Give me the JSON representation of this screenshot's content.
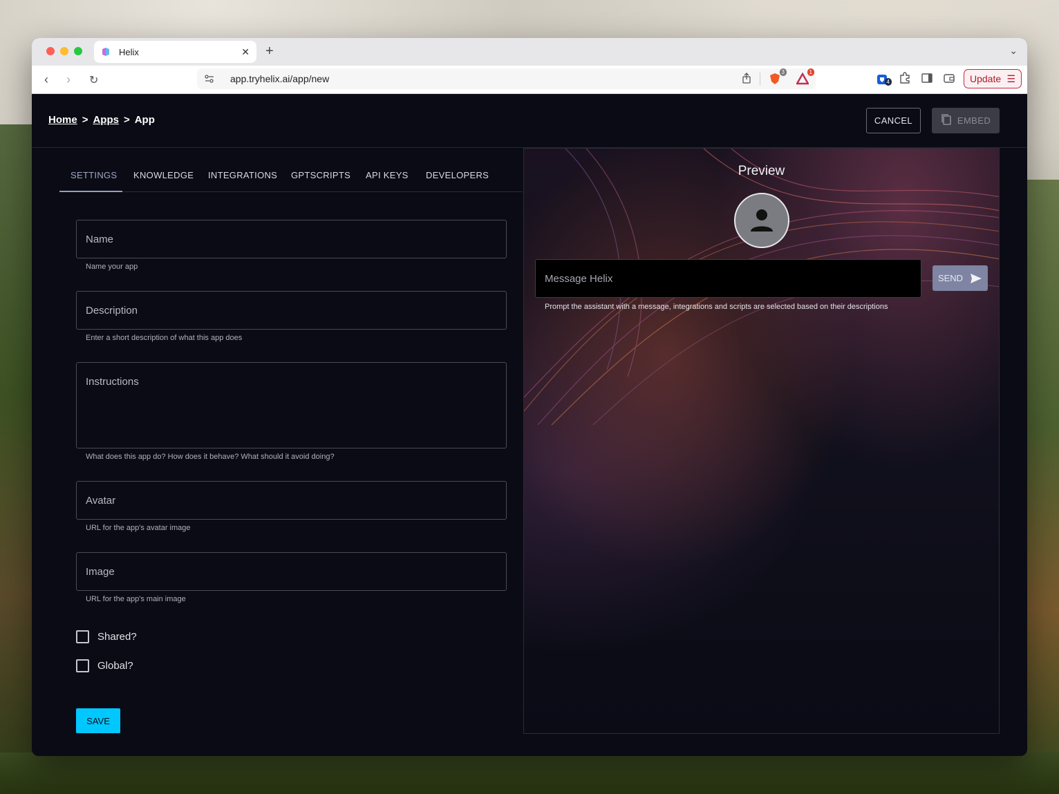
{
  "browser": {
    "tab_title": "Helix",
    "url": "app.tryhelix.ai/app/new",
    "update_label": "Update",
    "brave_badge": "3",
    "rewards_badge": "1",
    "ext_badge": "4"
  },
  "header": {
    "breadcrumb": {
      "home": "Home",
      "sep1": ">",
      "apps": "Apps",
      "sep2": ">",
      "current": "App"
    },
    "cancel_label": "CANCEL",
    "embed_label": "EMBED"
  },
  "tabs": [
    {
      "label": "SETTINGS",
      "active": true
    },
    {
      "label": "KNOWLEDGE"
    },
    {
      "label": "INTEGRATIONS"
    },
    {
      "label": "GPTSCRIPTS"
    },
    {
      "label": "API KEYS"
    },
    {
      "label": "DEVELOPERS"
    }
  ],
  "form": {
    "name": {
      "placeholder": "Name",
      "helper": "Name your app"
    },
    "description": {
      "placeholder": "Description",
      "helper": "Enter a short description of what this app does"
    },
    "instructions": {
      "placeholder": "Instructions",
      "helper": "What does this app do? How does it behave? What should it avoid doing?"
    },
    "avatar": {
      "placeholder": "Avatar",
      "helper": "URL for the app's avatar image"
    },
    "image": {
      "placeholder": "Image",
      "helper": "URL for the app's main image"
    },
    "shared_label": "Shared?",
    "global_label": "Global?",
    "save_label": "SAVE"
  },
  "preview": {
    "title": "Preview",
    "message_placeholder": "Message Helix",
    "send_label": "SEND",
    "helper": "Prompt the assistant with a message, integrations and scripts are selected based on their descriptions"
  },
  "colors": {
    "accent": "#00c8ff",
    "background": "#0a0b15",
    "update_red": "#c22a3a"
  }
}
